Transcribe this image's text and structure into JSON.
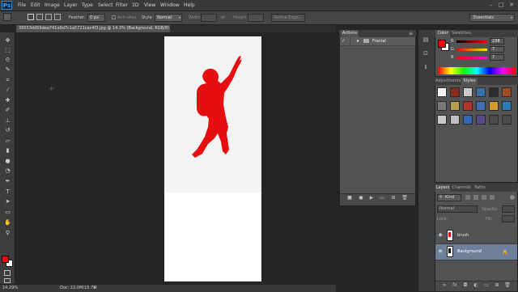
{
  "app": {
    "logo": "Ps"
  },
  "menu": [
    "File",
    "Edit",
    "Image",
    "Layer",
    "Type",
    "Select",
    "Filter",
    "3D",
    "View",
    "Window",
    "Help"
  ],
  "window_controls": [
    "–",
    "□",
    "✕"
  ],
  "options": {
    "feather_label": "Feather:",
    "feather_value": "0 px",
    "antialias_label": "Anti-alias",
    "style_label": "Style:",
    "style_value": "Normal",
    "width_label": "Width:",
    "height_label": "Height:",
    "refine_label": "Refine Edge...",
    "workspace": "Essentials"
  },
  "document": {
    "tab_title": "39553dd59daa741a9d7c1a5721cac4f3.jpg @ 14.3% (Background, RGB/8) *",
    "silhouette_color": "#e60e0e"
  },
  "status": {
    "zoom": "14.29%",
    "doc": "Doc: 22.0M/15.7M"
  },
  "actions_panel": {
    "tab": "Actions",
    "items": [
      {
        "name": "Fractal"
      }
    ]
  },
  "color_panel": {
    "tabs": [
      "Color",
      "Swatches"
    ],
    "channels": [
      {
        "label": "R",
        "value": "238"
      },
      {
        "label": "G",
        "value": "7"
      },
      {
        "label": "B",
        "value": "7"
      }
    ],
    "fg_color": "#ee0707",
    "bg_color": "#ffffff"
  },
  "styles_panel": {
    "tabs": [
      "Adjustments",
      "Styles"
    ]
  },
  "layers_panel": {
    "tabs": [
      "Layers",
      "Channels",
      "Paths"
    ],
    "filter_label": "Kind",
    "blend_mode": "Normal",
    "opacity_label": "Opacity:",
    "lock_label": "Lock:",
    "fill_label": "Fill:",
    "layers": [
      {
        "name": "brush",
        "active": false
      },
      {
        "name": "Background",
        "active": true
      }
    ]
  },
  "icons": [
    "move-icon",
    "marquee-icon",
    "lasso-icon",
    "quick-select-icon",
    "crop-icon",
    "eyedropper-icon",
    "healing-icon",
    "brush-icon",
    "stamp-icon",
    "history-brush-icon",
    "eraser-icon",
    "gradient-icon",
    "blur-icon",
    "dodge-icon",
    "pen-icon",
    "type-icon",
    "path-select-icon",
    "shape-icon",
    "hand-icon",
    "zoom-icon"
  ]
}
